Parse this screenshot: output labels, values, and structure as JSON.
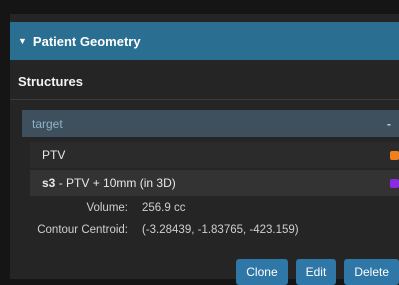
{
  "panel": {
    "title": "Patient Geometry",
    "section_title": "Structures"
  },
  "group": {
    "label": "target",
    "collapse_glyph": "-"
  },
  "structures": [
    {
      "name": "PTV",
      "color": "#f07f1e"
    },
    {
      "id": "s3",
      "separator": " - ",
      "name": "PTV + 10mm (in 3D)",
      "color": "#8a2be2"
    }
  ],
  "details": {
    "volume_label": "Volume:",
    "volume_value": "256.9 cc",
    "centroid_label": "Contour Centroid:",
    "centroid_value": "(-3.28439, -1.83765, -423.159)"
  },
  "buttons": {
    "clone": "Clone",
    "edit": "Edit",
    "delete": "Delete"
  },
  "colors": {
    "header": "#2a6f92",
    "button": "#2f77a6",
    "group_bg": "#3e4f5d"
  }
}
